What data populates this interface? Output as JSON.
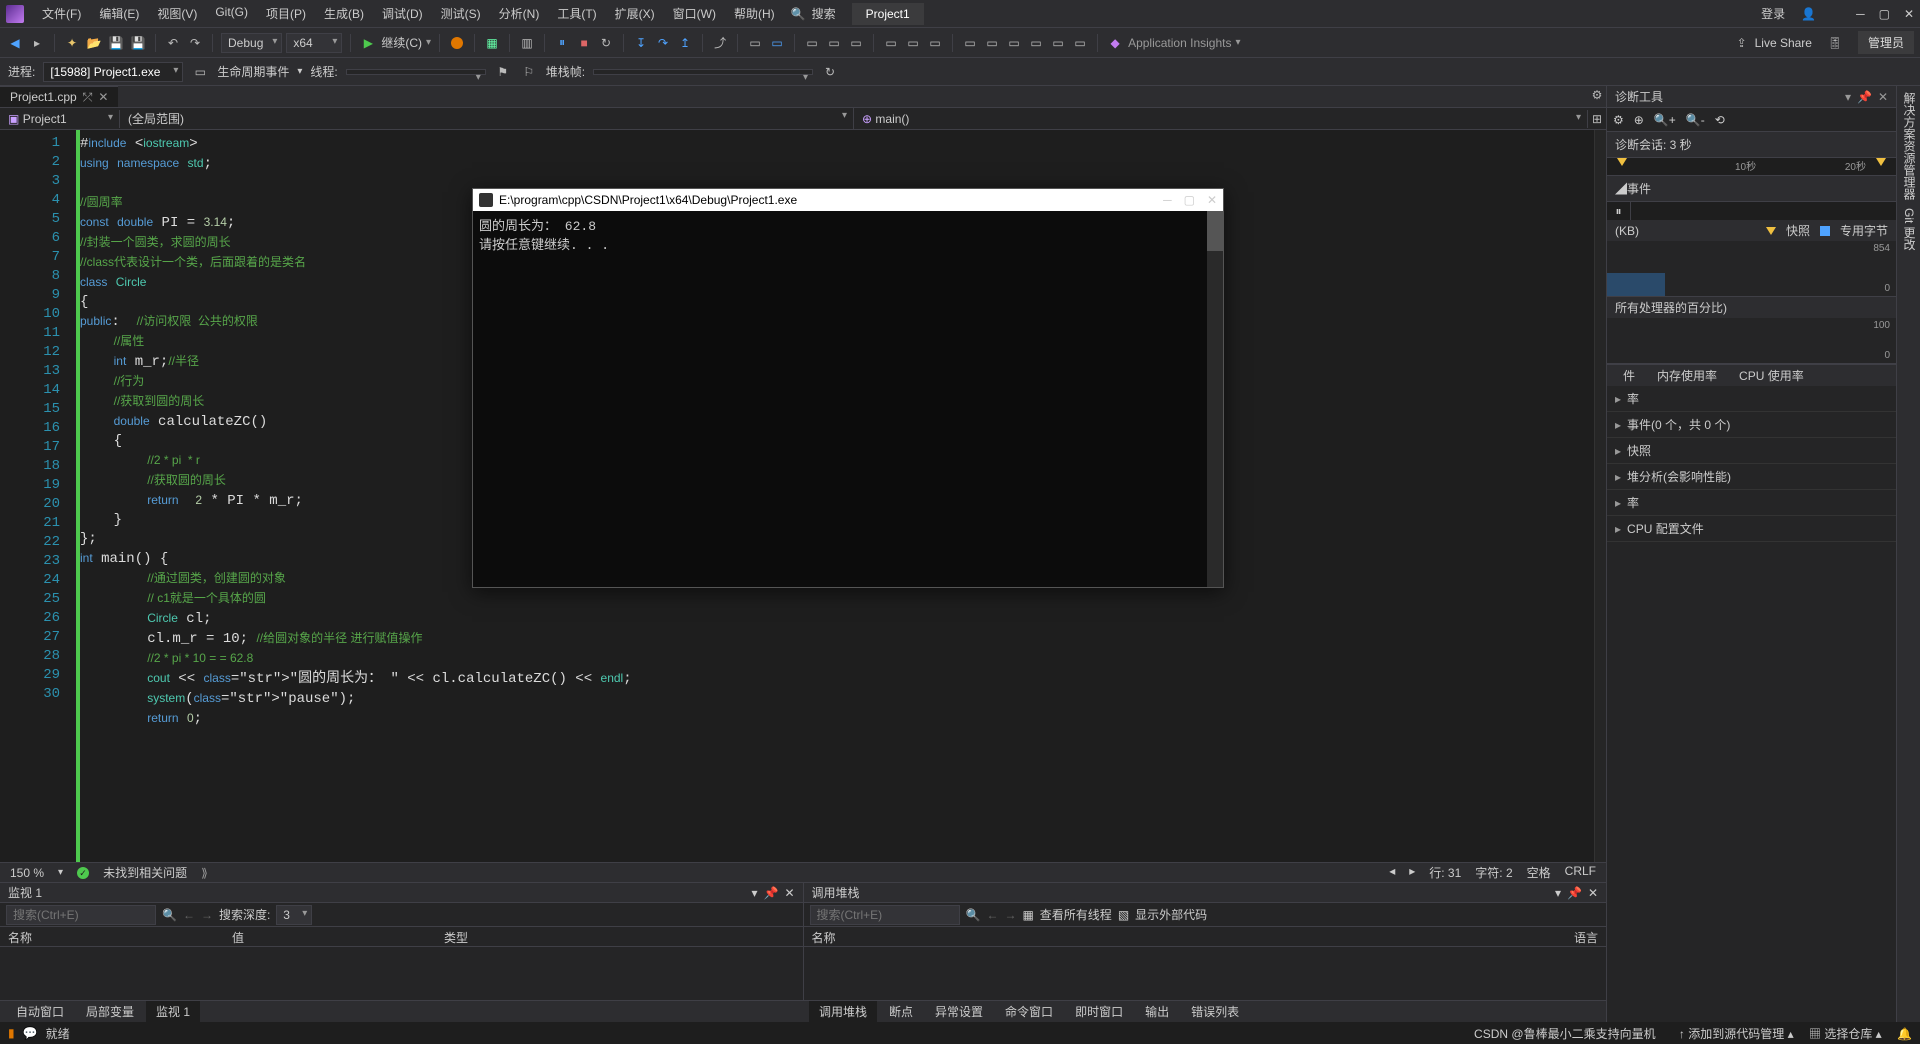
{
  "titleBar": {
    "project": "Project1",
    "login": "登录",
    "search": "搜索"
  },
  "menu": [
    "文件(F)",
    "编辑(E)",
    "视图(V)",
    "Git(G)",
    "项目(P)",
    "生成(B)",
    "调试(D)",
    "测试(S)",
    "分析(N)",
    "工具(T)",
    "扩展(X)",
    "窗口(W)",
    "帮助(H)"
  ],
  "toolbar": {
    "config": "Debug",
    "platform": "x64",
    "start": "继续(C)",
    "liveShare": "Live Share",
    "admin": "管理员",
    "appInsights": "Application Insights"
  },
  "toolbar2": {
    "process_lbl": "进程:",
    "process": "[15988] Project1.exe",
    "lifecycle": "生命周期事件",
    "thread_lbl": "线程:",
    "stackframe_lbl": "堆栈帧:"
  },
  "tab": {
    "name": "Project1.cpp"
  },
  "breadcrumb": {
    "a": "Project1",
    "b": "(全局范围)",
    "c": "main()"
  },
  "code": {
    "lines": [
      "#include <iostream>",
      "using namespace std;",
      "",
      "//圆周率",
      "const double PI = 3.14;",
      "//封装一个圆类，求圆的周长",
      "//class代表设计一个类，后面跟着的是类名",
      "class Circle",
      "{",
      "public:  //访问权限  公共的权限",
      "    //属性",
      "    int m_r;//半径",
      "    //行为",
      "    //获取到圆的周长",
      "    double calculateZC()",
      "    {",
      "        //2 * pi  * r",
      "        //获取圆的周长",
      "        return  2 * PI * m_r;",
      "    }",
      "};",
      "int main() {",
      "        //通过圆类，创建圆的对象",
      "        // c1就是一个具体的圆",
      "        Circle cl;",
      "        cl.m_r = 10; //给圆对象的半径 进行赋值操作",
      "        //2 * pi * 10 = = 62.8",
      "        cout << \"圆的周长为： \" << cl.calculateZC() << endl;",
      "        system(\"pause\");",
      "        return 0;"
    ]
  },
  "codeStatus": {
    "zoom": "150 %",
    "issue": "未找到相关问题",
    "line": "行: 31",
    "col": "字符: 2",
    "ins": "空格",
    "eol": "CRLF"
  },
  "watch": {
    "title": "监视 1",
    "search_ph": "搜索(Ctrl+E)",
    "depth_lbl": "搜索深度:",
    "depth": "3",
    "col_name": "名称",
    "col_val": "值",
    "col_type": "类型"
  },
  "callstack": {
    "title": "调用堆栈",
    "search_ph": "搜索(Ctrl+E)",
    "show_threads": "查看所有线程",
    "show_ext": "显示外部代码",
    "col_name": "名称",
    "col_lang": "语言"
  },
  "bottomTabsL": [
    "自动窗口",
    "局部变量",
    "监视 1"
  ],
  "bottomTabsR": [
    "调用堆栈",
    "断点",
    "异常设置",
    "命令窗口",
    "即时窗口",
    "输出",
    "错误列表"
  ],
  "status": {
    "ready": "就绪",
    "watermark": "CSDN @鲁棒最小二乘支持向量机",
    "addsrc": "添加到源代码管理",
    "selrepo": "选择仓库"
  },
  "console": {
    "title": "E:\\program\\cpp\\CSDN\\Project1\\x64\\Debug\\Project1.exe",
    "out": "圆的周长为： 62.8\n请按任意键继续. . ."
  },
  "diag": {
    "title": "诊断工具",
    "session": "诊断会话: 3 秒",
    "tmarks": [
      "10秒",
      "20秒"
    ],
    "events_hdr": "◢事件",
    "mem_hdr": "(KB)",
    "mem_max": "854",
    "mem_zero": "0",
    "mem_legend_a": "快照",
    "mem_legend_b": "专用字节",
    "cpu_hdr": "所有处理器的百分比)",
    "cpu_max": "100",
    "cpu_zero": "0",
    "tabs": [
      "件",
      "内存使用率",
      "CPU 使用率"
    ],
    "rows": [
      "率",
      "事件(0 个，共 0 个)",
      "快照",
      "堆分析(会影响性能)",
      "率",
      "CPU 配置文件"
    ]
  },
  "rightDock": [
    "解决方案资源管理器",
    "Git 更改"
  ]
}
